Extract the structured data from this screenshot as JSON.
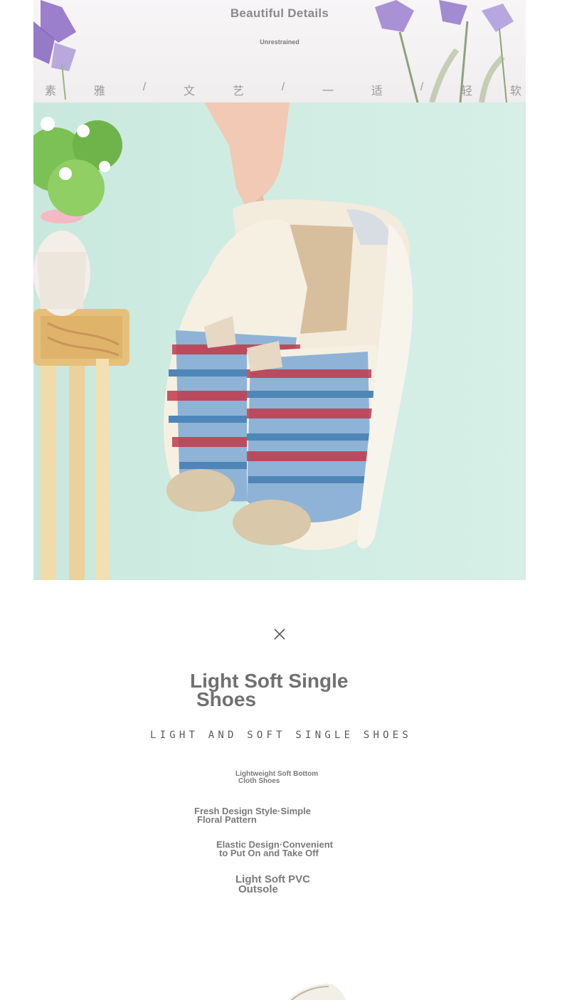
{
  "banner": {
    "title": "Beautiful Details",
    "subtitle": "Unrestrained",
    "chinese": [
      "素",
      "雅",
      "/",
      "文",
      "艺",
      "/",
      "一",
      "适",
      "/",
      "轻",
      "软"
    ]
  },
  "photo": {
    "subject": "",
    "colors": {
      "background": "#cfece2",
      "shoe_red": "#c2384a",
      "shoe_blue": "#4f86b8"
    }
  },
  "close_icon": "close-icon",
  "feature": {
    "headline_line1": "Light Soft Single",
    "headline_line2": "Shoes",
    "subheading": "LIGHT AND SOFT SINGLE SHOES",
    "items": [
      {
        "line1": "Lightweight Soft Bottom",
        "line2": "Cloth Shoes"
      },
      {
        "line1": "Fresh Design Style·Simple",
        "line2": "Floral Pattern"
      },
      {
        "line1": "Elastic Design·Convenient",
        "line2": "to Put On and Take Off"
      },
      {
        "line1": "Light Soft PVC",
        "line2": "Outsole"
      }
    ]
  }
}
